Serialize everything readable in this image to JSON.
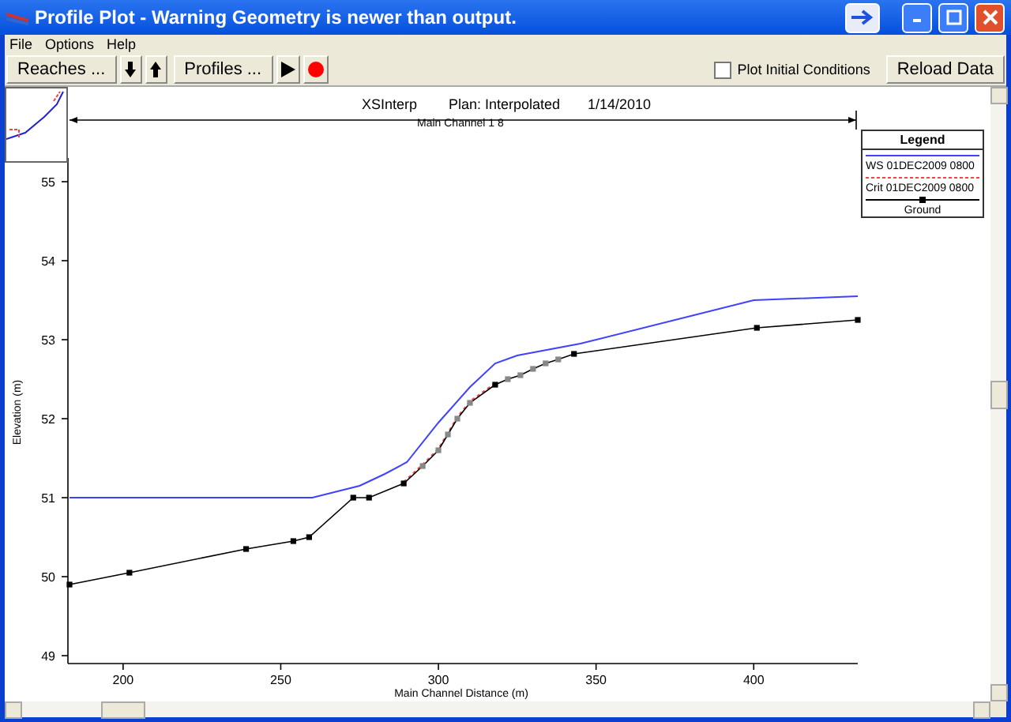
{
  "window": {
    "title": "Profile Plot - Warning Geometry is newer than output."
  },
  "menu": [
    "File",
    "Options",
    "Help"
  ],
  "toolbar": {
    "buttons": [
      {
        "kind": "text",
        "label": "Reaches ..."
      },
      {
        "kind": "down"
      },
      {
        "kind": "up"
      },
      {
        "kind": "text",
        "label": "Profiles ..."
      },
      {
        "kind": "play"
      },
      {
        "kind": "record"
      }
    ],
    "plot_initial_conditions": {
      "label": "Plot Initial Conditions",
      "checked": false
    },
    "reload": "Reload Data"
  },
  "plot": {
    "header": [
      "XSInterp",
      "Plan: Interpolated",
      "1/14/2010"
    ],
    "reach_label": "Main Channel 1 8",
    "legend_title": "Legend",
    "chart_data": {
      "type": "line",
      "xlabel": "Main Channel Distance (m)",
      "ylabel": "Elevation (m)",
      "xlim": [
        182.5,
        433
      ],
      "ylim": [
        48.9,
        55.3
      ],
      "xticks": [
        200,
        250,
        300,
        350,
        400
      ],
      "yticks": [
        49,
        50,
        51,
        52,
        53,
        54,
        55
      ],
      "series": [
        {
          "name": "WS  01DEC2009 0800",
          "color": "#4040ff",
          "line_style": "solid",
          "x": [
            183,
            260,
            275,
            283,
            290,
            300,
            310,
            318,
            325,
            345,
            400,
            433
          ],
          "values": [
            51,
            51,
            51.15,
            51.3,
            51.45,
            51.95,
            52.4,
            52.7,
            52.8,
            52.95,
            53.5,
            53.55
          ]
        },
        {
          "name": "Crit  01DEC2009 0800",
          "color": "#ff4040",
          "line_style": "dotted",
          "x": [
            289,
            295,
            300,
            303,
            306,
            310,
            318
          ],
          "values": [
            51.2,
            51.42,
            51.62,
            51.82,
            52.02,
            52.22,
            52.45
          ]
        },
        {
          "name": "Ground",
          "color": "#000000",
          "line_style": "solid",
          "marker": "square",
          "x": [
            183,
            202,
            239,
            254,
            259,
            273,
            278,
            289,
            295,
            300,
            303,
            306,
            310,
            318,
            322,
            326,
            330,
            334,
            338,
            343,
            401,
            433
          ],
          "values": [
            49.9,
            50.05,
            50.35,
            50.45,
            50.5,
            51,
            51,
            51.18,
            51.4,
            51.6,
            51.8,
            52,
            52.2,
            52.43,
            52.5,
            52.55,
            52.63,
            52.7,
            52.75,
            52.82,
            53.15,
            53.25
          ]
        }
      ]
    }
  }
}
